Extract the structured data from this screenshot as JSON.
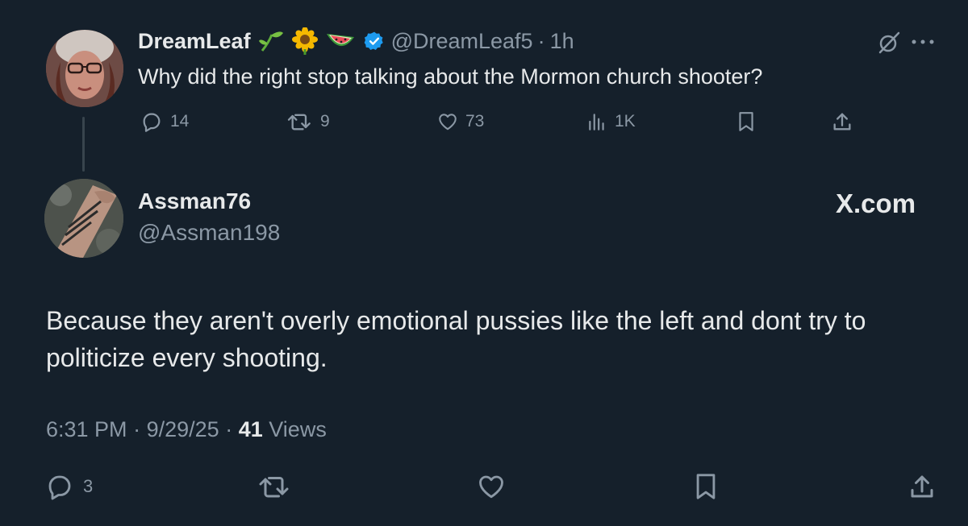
{
  "parent": {
    "name": "DreamLeaf",
    "emojis": [
      "🌱",
      "🌻",
      "🍉"
    ],
    "handle": "@DreamLeaf5",
    "separator": "·",
    "time": "1h",
    "text": "Why did the right stop talking about the Mormon church shooter?",
    "actions": {
      "replies": "14",
      "reposts": "9",
      "likes": "73",
      "views": "1K"
    },
    "verified_color": "#1d9bf0"
  },
  "reply": {
    "name": "Assman76",
    "handle": "@Assman198",
    "brand": "X.com",
    "text": "Because they aren't overly emotional pussies like the left and dont try to politicize every shooting.",
    "time": "6:31 PM",
    "date": "9/29/25",
    "separator": "·",
    "views_count": "41",
    "views_label": "Views",
    "actions": {
      "replies": "3"
    }
  },
  "colors": {
    "background": "#15202b",
    "text_primary": "#e7e9ea",
    "text_secondary": "#8b98a5",
    "thread_line": "#38444d"
  },
  "icons": [
    "reply-icon",
    "repost-icon",
    "like-icon",
    "views-icon",
    "bookmark-icon",
    "share-icon",
    "grok-icon",
    "more-icon",
    "verified-icon",
    "x-logo-icon"
  ]
}
